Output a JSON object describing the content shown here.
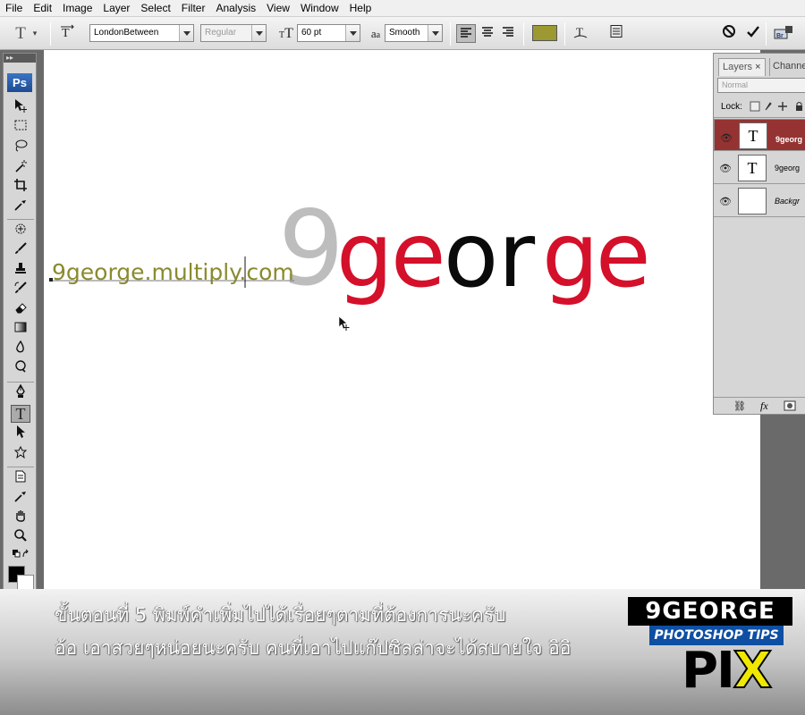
{
  "menu": [
    "File",
    "Edit",
    "Image",
    "Layer",
    "Select",
    "Filter",
    "Analysis",
    "View",
    "Window",
    "Help"
  ],
  "options": {
    "font_family": "LondonBetween",
    "font_style": "Regular",
    "font_size": "60 pt",
    "aa_label": "a",
    "antialias": "Smooth",
    "text_color": "#9c9832",
    "br_label": "Br"
  },
  "toolbox": {
    "logo": "Ps"
  },
  "canvas": {
    "url_text": "9george.multiply.com",
    "url_color": "#8a8a2e",
    "logo_nine": "9",
    "logo_letters": [
      {
        "ch": "g",
        "color": "#d4102a"
      },
      {
        "ch": "e",
        "color": "#d4102a"
      },
      {
        "ch": "o",
        "color": "#0a0a0a"
      },
      {
        "ch": "r",
        "color": "#0a0a0a"
      },
      {
        "ch": "g",
        "color": "#d4102a"
      },
      {
        "ch": "e",
        "color": "#d4102a"
      }
    ],
    "nine_color": "#bdbdbd"
  },
  "layers_panel": {
    "tab_active": "Layers",
    "tab_inactive": "Channe",
    "blend_mode": "Normal",
    "lock_label": "Lock:",
    "layers": [
      {
        "name": "9georg",
        "thumb": "T",
        "selected": true
      },
      {
        "name": "9georg",
        "thumb": "T",
        "selected": false
      },
      {
        "name": "Backgr",
        "thumb": "",
        "selected": false
      }
    ],
    "fx_label": "fx"
  },
  "caption": {
    "line1": "ขั้นตอนที่ 5 พิมพ์คำเพิ่มไปได้เรื่อยๆตามที่ต้องการนะครับ",
    "line2": "อ้อ เอาสวยๆหน่อยนะครับ คนที่เอาไปแก๊ปซิลล่าจะได้สบายใจ อิอิ"
  },
  "brand": {
    "line1": "9GEORGE",
    "line2": "PHOTOSHOP TIPS",
    "line3a": "PI",
    "line3b": "X"
  }
}
